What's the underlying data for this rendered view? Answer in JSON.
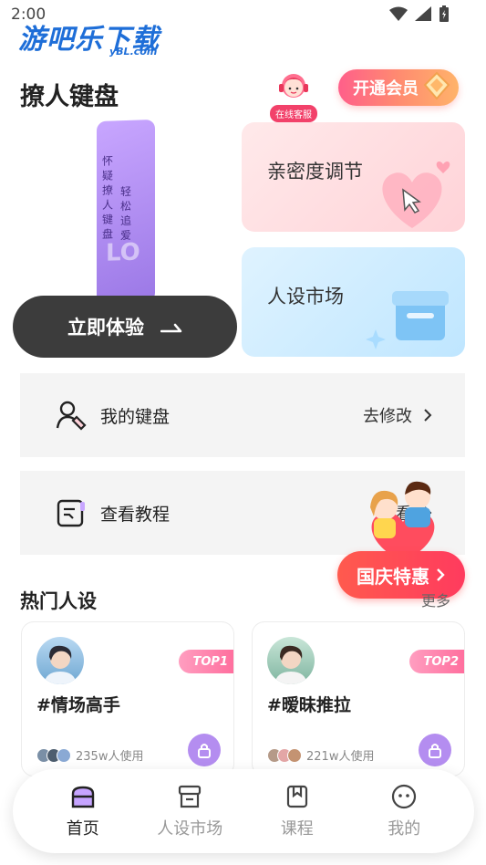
{
  "status": {
    "time": "2:00"
  },
  "watermark": {
    "text": "游吧乐下载",
    "sub": "yBL.com"
  },
  "header": {
    "title": "撩人键盘",
    "service_label": "在线客服",
    "vip_label": "开通会员"
  },
  "hero": {
    "phone_text_1": "怀疑撩人键盘",
    "phone_text_2": "轻松追爱",
    "phone_text_3": "LO",
    "try_label": "立即体验"
  },
  "cards": {
    "intimacy": "亲密度调节",
    "persona": "人设市场"
  },
  "rows": {
    "keyboard": {
      "label": "我的键盘",
      "action": "去修改"
    },
    "tutorial": {
      "label": "查看教程",
      "action": "查看"
    }
  },
  "promo": {
    "label": "国庆特惠"
  },
  "section": {
    "title": "热门人设",
    "more": "更多"
  },
  "personas": [
    {
      "name": "#情场高手",
      "badge": "TOP1",
      "count": "235w人使用"
    },
    {
      "name": "#暧昧推拉",
      "badge": "TOP2",
      "count": "221w人使用"
    }
  ],
  "tabs": [
    {
      "label": "首页",
      "icon": "home-icon"
    },
    {
      "label": "人设市场",
      "icon": "store-icon"
    },
    {
      "label": "课程",
      "icon": "bookmark-icon"
    },
    {
      "label": "我的",
      "icon": "profile-icon"
    }
  ],
  "colors": {
    "accent": "#b48df0",
    "vip": "#ff7a7a",
    "promo": "#ff4a55"
  }
}
